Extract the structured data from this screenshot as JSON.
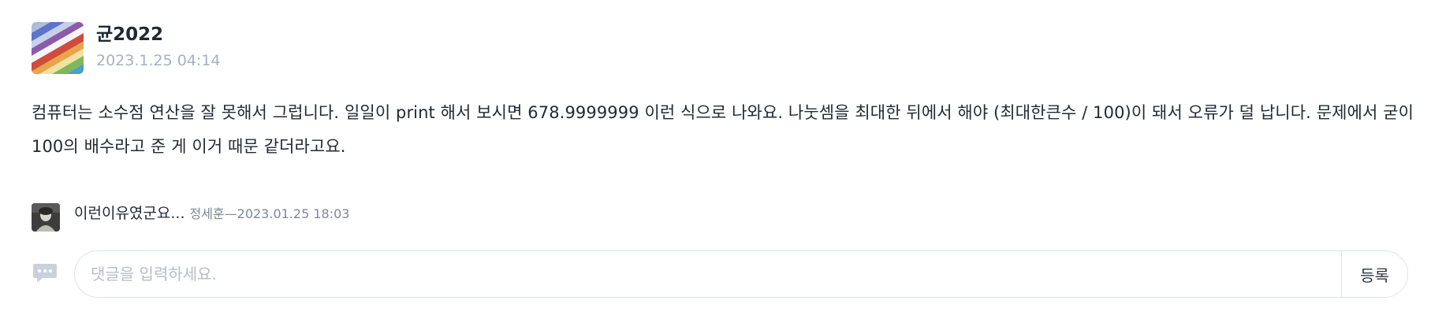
{
  "comment": {
    "author": "균2022",
    "date": "2023.1.25 04:14",
    "body": "컴퓨터는 소수점 연산을 잘 못해서 그럽니다. 일일이 print 해서 보시면 678.9999999 이런 식으로 나와요. 나눗셈을 최대한 뒤에서 해야 (최대한큰수 / 100)이 돼서 오류가 덜 납니다. 문제에서 굳이 100의 배수라고 준 게 이거 때문 같더라고요."
  },
  "reply": {
    "text": "이런이유였군요...",
    "author_and_date": "정세훈—2023.01.25 18:03"
  },
  "input": {
    "placeholder": "댓글을 입력하세요.",
    "submit_label": "등록"
  },
  "icons": {
    "comment_avatar": "colorful-stripes-avatar",
    "reply_avatar": "portrait-avatar",
    "chat": "speech-bubble-icon"
  },
  "colors": {
    "muted_text": "#a7b1bd",
    "chat_icon": "#c9d2dc",
    "border": "#dfe3e8"
  }
}
